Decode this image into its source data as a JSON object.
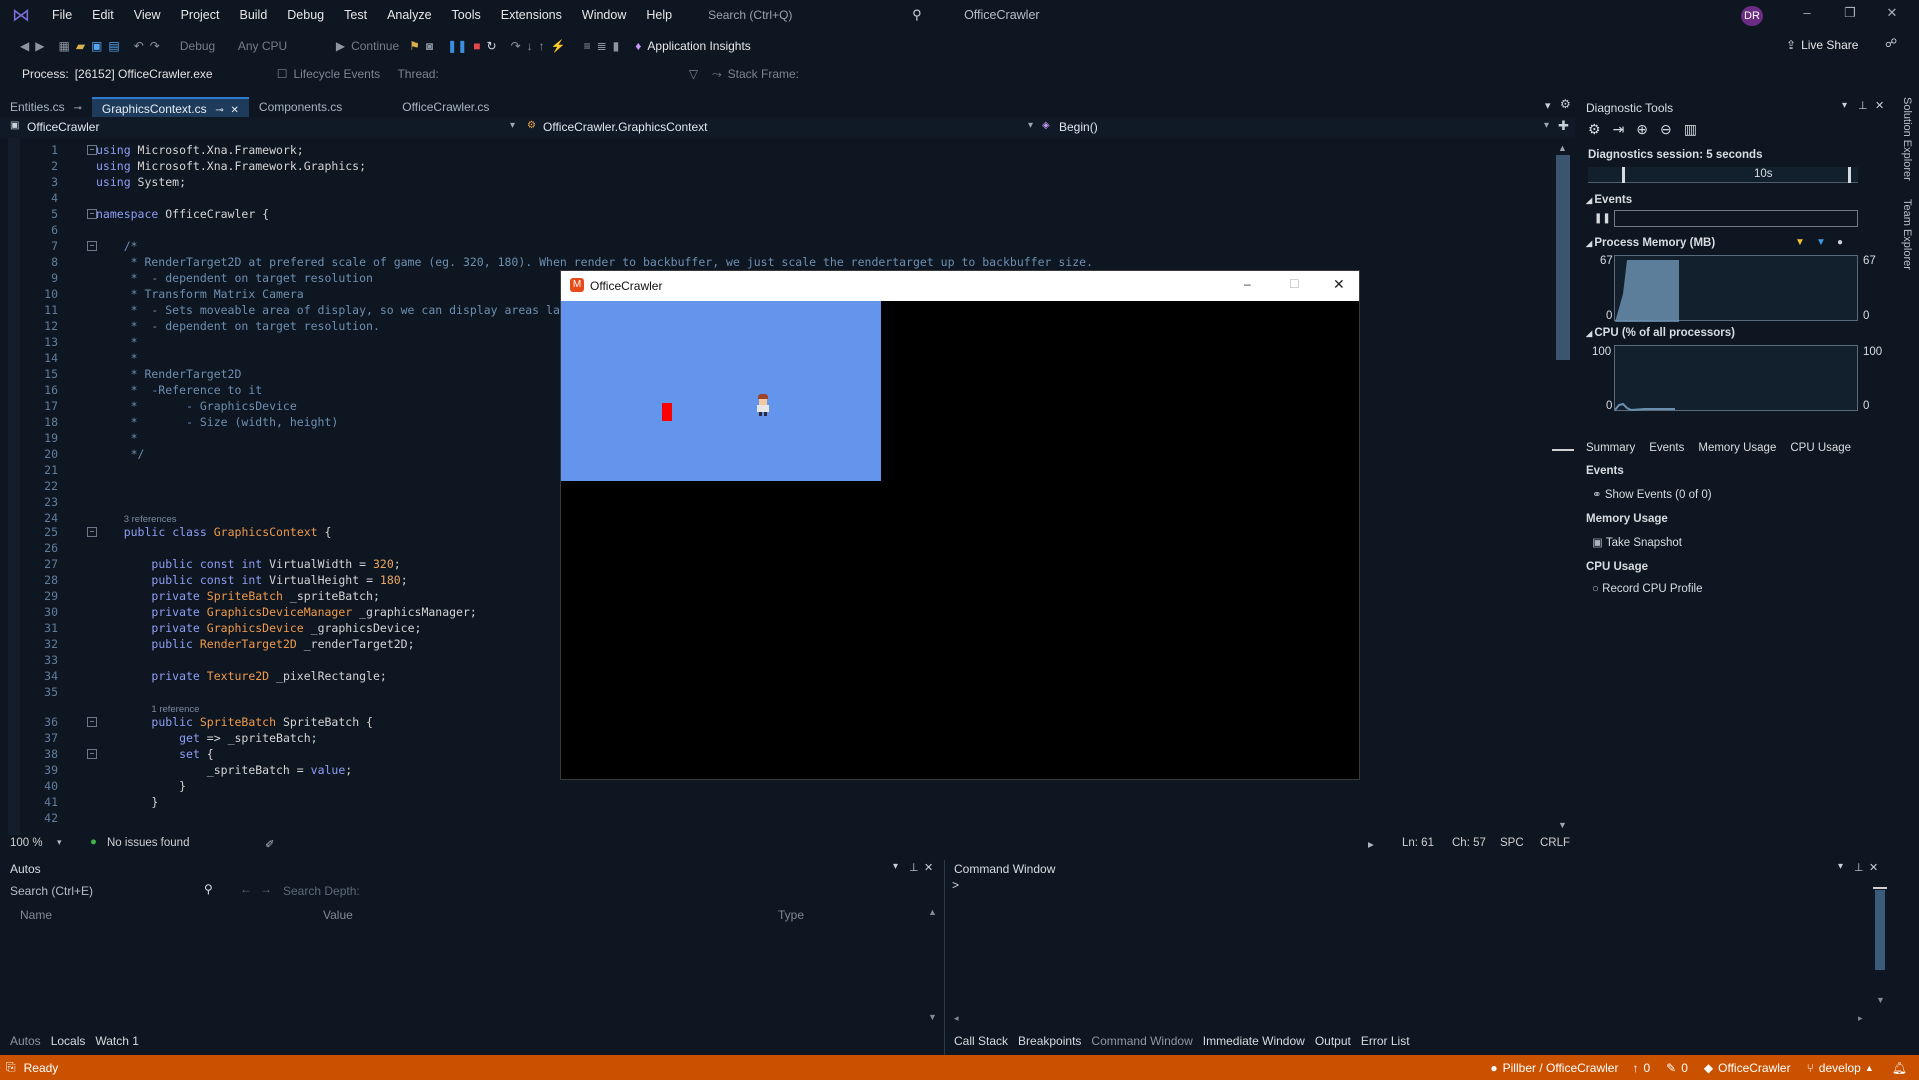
{
  "window": {
    "title": "OfficeCrawler",
    "avatar_initials": "DR"
  },
  "menu": [
    "File",
    "Edit",
    "View",
    "Project",
    "Build",
    "Debug",
    "Test",
    "Analyze",
    "Tools",
    "Extensions",
    "Window",
    "Help"
  ],
  "search": {
    "placeholder": "Search (Ctrl+Q)"
  },
  "toolbar": {
    "configuration": "Debug",
    "platform": "Any CPU",
    "continue_label": "Continue",
    "app_insights": "Application Insights",
    "live_share": "Live Share"
  },
  "debug_bar": {
    "process_label": "Process:",
    "process_value": "[26152] OfficeCrawler.exe",
    "lifecycle_label": "Lifecycle Events",
    "thread_label": "Thread:",
    "stack_frame_label": "Stack Frame:"
  },
  "tabs": [
    {
      "label": "Entities.cs",
      "active": false,
      "pinned": true
    },
    {
      "label": "GraphicsContext.cs",
      "active": true,
      "pinned": true
    },
    {
      "label": "Components.cs",
      "active": false,
      "pinned": false
    },
    {
      "label": "OfficeCrawler.cs",
      "active": false,
      "pinned": false
    }
  ],
  "navbar": {
    "project": "OfficeCrawler",
    "type": "OfficeCrawler.GraphicsContext",
    "member": "Begin()"
  },
  "code_lines": [
    {
      "n": "1",
      "html": "<span class=\"kw\">using</span> Microsoft.Xna.Framework;",
      "fold": "-"
    },
    {
      "n": "2",
      "html": "<span class=\"kw\">using</span> Microsoft.Xna.Framework.Graphics;"
    },
    {
      "n": "3",
      "html": "<span class=\"kw\">using</span> System;"
    },
    {
      "n": "4",
      "html": ""
    },
    {
      "n": "5",
      "html": "<span class=\"kw\">namespace</span> OfficeCrawler {",
      "fold": "-"
    },
    {
      "n": "6",
      "html": ""
    },
    {
      "n": "7",
      "html": "    <span class=\"cm\">/*</span>",
      "fold": "-"
    },
    {
      "n": "8",
      "html": "<span class=\"cm\">     * RenderTarget2D at prefered scale of game (eg. 320, 180). When render to backbuffer, we just scale the rendertarget up to backbuffer size.</span>"
    },
    {
      "n": "9",
      "html": "<span class=\"cm\">     *  - dependent on target resolution</span>"
    },
    {
      "n": "10",
      "html": "<span class=\"cm\">     * Transform Matrix Camera</span>"
    },
    {
      "n": "11",
      "html": "<span class=\"cm\">     *  - Sets moveable area of display, so we can display areas larger than the screen.</span>"
    },
    {
      "n": "12",
      "html": "<span class=\"cm\">     *  - dependent on target resolution.</span>"
    },
    {
      "n": "13",
      "html": "<span class=\"cm\">     *</span>"
    },
    {
      "n": "14",
      "html": "<span class=\"cm\">     *</span>"
    },
    {
      "n": "15",
      "html": "<span class=\"cm\">     * RenderTarget2D</span>"
    },
    {
      "n": "16",
      "html": "<span class=\"cm\">     *  -Reference to it</span>"
    },
    {
      "n": "17",
      "html": "<span class=\"cm\">     *       - GraphicsDevice</span>"
    },
    {
      "n": "18",
      "html": "<span class=\"cm\">     *       - Size (width, height)</span>"
    },
    {
      "n": "19",
      "html": "<span class=\"cm\">     *</span>"
    },
    {
      "n": "20",
      "html": "<span class=\"cm\">     */</span>"
    },
    {
      "n": "21",
      "html": ""
    },
    {
      "n": "22",
      "html": ""
    },
    {
      "n": "23",
      "html": ""
    },
    {
      "n": "24",
      "html": "    <span class=\"ref\">3 references</span>",
      "ref": true
    },
    {
      "n": "25",
      "html": "    <span class=\"kw\">public</span> <span class=\"kw\">class</span> <span class=\"ty\">GraphicsContext</span> {",
      "fold": "-"
    },
    {
      "n": "26",
      "html": ""
    },
    {
      "n": "27",
      "html": "        <span class=\"kw\">public</span> <span class=\"kw\">const</span> <span class=\"kw\">int</span> VirtualWidth = <span class=\"num\">320</span>;"
    },
    {
      "n": "28",
      "html": "        <span class=\"kw\">public</span> <span class=\"kw\">const</span> <span class=\"kw\">int</span> VirtualHeight = <span class=\"num\">180</span>;"
    },
    {
      "n": "29",
      "html": "        <span class=\"kw\">private</span> <span class=\"ty\">SpriteBatch</span> _spriteBatch;"
    },
    {
      "n": "30",
      "html": "        <span class=\"kw\">private</span> <span class=\"ty\">GraphicsDeviceManager</span> _graphicsManager;"
    },
    {
      "n": "31",
      "html": "        <span class=\"kw\">private</span> <span class=\"ty\">GraphicsDevice</span> _graphicsDevice;"
    },
    {
      "n": "32",
      "html": "        <span class=\"kw\">public</span> <span class=\"ty\">RenderTarget2D</span> _renderTarget2D;"
    },
    {
      "n": "33",
      "html": ""
    },
    {
      "n": "34",
      "html": "        <span class=\"kw\">private</span> <span class=\"ty\">Texture2D</span> _pixelRectangle;"
    },
    {
      "n": "35",
      "html": ""
    },
    {
      "n": "",
      "html": "        <span class=\"ref\">1 reference</span>",
      "ref": true
    },
    {
      "n": "36",
      "html": "        <span class=\"kw\">public</span> <span class=\"ty\">SpriteBatch</span> SpriteBatch {",
      "fold": "-"
    },
    {
      "n": "37",
      "html": "            <span class=\"kw\">get</span> => _spriteBatch;"
    },
    {
      "n": "38",
      "html": "            <span class=\"kw\">set</span> {",
      "fold": "-"
    },
    {
      "n": "39",
      "html": "                _spriteBatch = <span class=\"kw\">value</span>;"
    },
    {
      "n": "40",
      "html": "            }"
    },
    {
      "n": "41",
      "html": "        }"
    },
    {
      "n": "42",
      "html": ""
    }
  ],
  "editor_status": {
    "zoom": "100 %",
    "issues": "No issues found",
    "ln": "Ln: 61",
    "ch": "Ch: 57",
    "spc": "SPC",
    "crlf": "CRLF"
  },
  "game_window": {
    "title": "OfficeCrawler"
  },
  "diagnostics": {
    "title": "Diagnostic Tools",
    "session": "Diagnostics session: 5 seconds",
    "timeline_label": "10s",
    "events_label": "Events",
    "memory_label": "Process Memory (MB)",
    "memory_max": "67",
    "memory_min": "0",
    "cpu_label": "CPU (% of all processors)",
    "cpu_max": "100",
    "cpu_min": "0",
    "tabs": [
      "Summary",
      "Events",
      "Memory Usage",
      "CPU Usage"
    ],
    "sections": [
      {
        "heading": "Events",
        "action": "Show Events (0 of 0)"
      },
      {
        "heading": "Memory Usage",
        "action": "Take Snapshot"
      },
      {
        "heading": "CPU Usage",
        "action": "Record CPU Profile"
      }
    ]
  },
  "autos": {
    "title": "Autos",
    "search_placeholder": "Search (Ctrl+E)",
    "depth_label": "Search Depth:",
    "columns": [
      "Name",
      "Value",
      "Type"
    ],
    "tabs": [
      "Autos",
      "Locals",
      "Watch 1"
    ]
  },
  "command_window": {
    "title": "Command Window",
    "prompt": ">",
    "tabs": [
      "Call Stack",
      "Breakpoints",
      "Command Window",
      "Immediate Window",
      "Output",
      "Error List"
    ]
  },
  "right_rail": [
    "Solution Explorer",
    "Team Explorer"
  ],
  "statusbar": {
    "ready": "Ready",
    "repo": "Pillber / OfficeCrawler",
    "up_count": "0",
    "edit_count": "0",
    "project": "OfficeCrawler",
    "branch": "develop"
  },
  "colors": {
    "accent": "#ca5100",
    "game_sky": "#6495ed",
    "active_tab": "#1f3b5b"
  }
}
